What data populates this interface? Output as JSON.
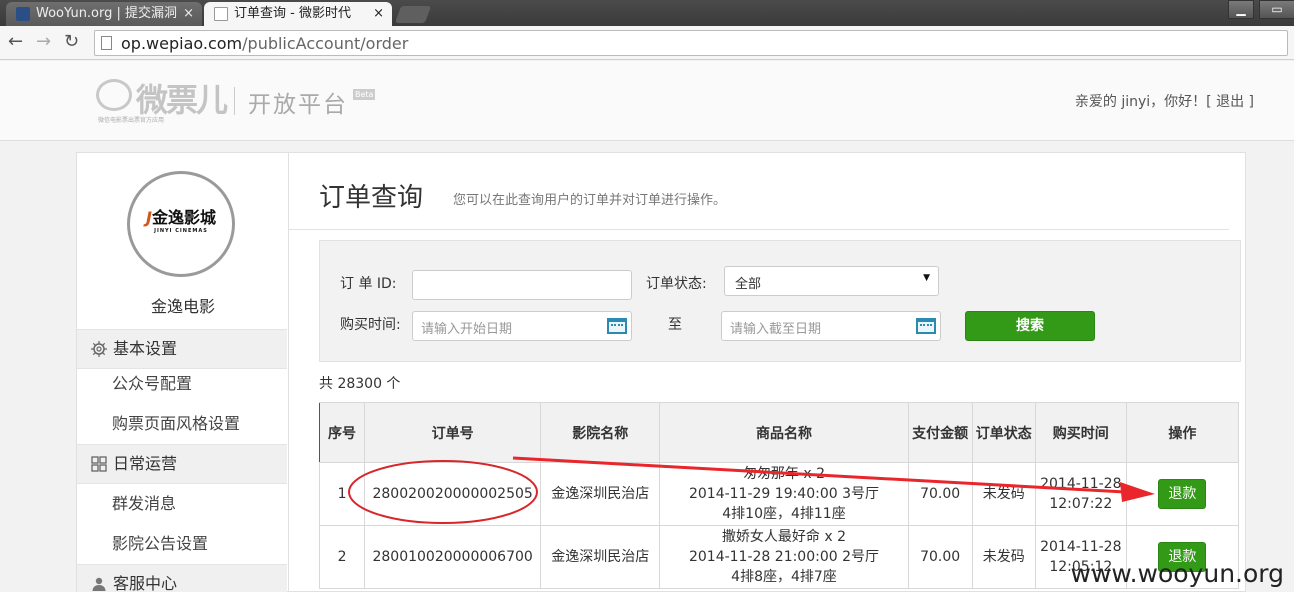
{
  "browser": {
    "tabs": [
      {
        "label": "WooYun.org | 提交漏洞",
        "active": false
      },
      {
        "label": "订单查询 - 微影时代",
        "active": true
      }
    ],
    "close_glyph": "×",
    "url_host": "op.wepiao.com",
    "url_path": "/publicAccount/order",
    "icons": [
      "back-arrow-icon",
      "forward-arrow-icon",
      "reload-icon",
      "page-icon"
    ]
  },
  "header": {
    "logo_text": "微票儿",
    "logo_tagline": "微信电影票出票官方应用",
    "platform": "开放平台",
    "beta": "Beta",
    "greeting": "亲爱的 jinyi，你好！[",
    "logout": "退出",
    "greeting_end": "]"
  },
  "sidebar": {
    "cinema_logo_cn": "金逸影城",
    "cinema_logo_en": "JINYI CINEMAS",
    "cinema_name": "金逸电影",
    "sections": [
      {
        "label": "基本设置",
        "icon": "gear-icon",
        "items": [
          "公众号配置",
          "购票页面风格设置"
        ]
      },
      {
        "label": "日常运营",
        "icon": "grid-icon",
        "items": [
          "群发消息",
          "影院公告设置"
        ]
      },
      {
        "label": "客服中心",
        "icon": "user-icon",
        "items": []
      }
    ]
  },
  "main": {
    "title": "订单查询",
    "description": "您可以在此查询用户的订单并对订单进行操作。",
    "search": {
      "order_id_label": "订 单 ID:",
      "order_id_value": "",
      "status_label": "订单状态:",
      "status_value": "全部",
      "time_label": "购买时间:",
      "start_placeholder": "请输入开始日期",
      "to_label": "至",
      "end_placeholder": "请输入截至日期",
      "search_button": "搜索"
    },
    "total": "共 28300 个",
    "table": {
      "headers": [
        "序号",
        "订单号",
        "影院名称",
        "商品名称",
        "支付金额",
        "订单状态",
        "购买时间",
        "操作"
      ],
      "rows": [
        {
          "seq": "1",
          "order_no": "280020020000002505",
          "cinema": "金逸深圳民治店",
          "product_line1": "匆匆那年 x 2",
          "product_line2": "2014-11-29 19:40:00 3号厅",
          "product_line3": "4排10座，4排11座",
          "amount": "70.00",
          "status": "未发码",
          "time_date": "2014-11-28",
          "time_clock": "12:07:22",
          "action": "退款"
        },
        {
          "seq": "2",
          "order_no": "280010020000006700",
          "cinema": "金逸深圳民治店",
          "product_line1": "撒娇女人最好命 x 2",
          "product_line2": "2014-11-28 21:00:00 2号厅",
          "product_line3": "4排8座，4排7座",
          "amount": "70.00",
          "status": "未发码",
          "time_date": "2014-11-28",
          "time_clock": "12:05:12",
          "action": "退款"
        }
      ]
    }
  },
  "annotation": {
    "watermark": "www.wooyun.org",
    "circle_color": "#d8262b",
    "arrow_color": "#e8262b"
  },
  "colors": {
    "green_button": "#339a17"
  }
}
